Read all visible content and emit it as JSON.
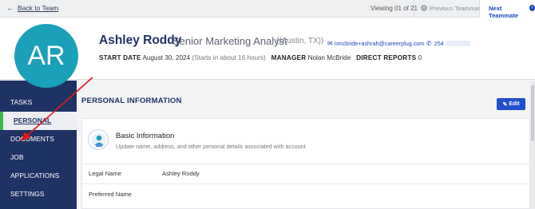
{
  "topbar": {
    "back_label": "Back to Team",
    "viewing": "Viewing 01 of 21",
    "previous_label": "Previous Teammate",
    "next_label": "Next Teammate"
  },
  "profile": {
    "initials": "AR",
    "name": "Ashley Roddy",
    "job_title": "Senior Marketing Analyst",
    "location": "((Austin, TX))",
    "email": "nmcbride+ashrah@careerplug.com",
    "phone": "254",
    "start_date_label": "START DATE",
    "start_date": "August 30, 2024",
    "start_note": "(Starts in about 16 hours)",
    "manager_label": "MANAGER",
    "manager": "Nolan McBride",
    "reports_label": "DIRECT REPORTS",
    "reports": "0"
  },
  "sidebar": {
    "items": [
      {
        "label": "TASKS"
      },
      {
        "label": "PERSONAL"
      },
      {
        "label": "DOCUMENTS"
      },
      {
        "label": "JOB"
      },
      {
        "label": "APPLICATIONS"
      },
      {
        "label": "SETTINGS"
      }
    ],
    "active": "PERSONAL"
  },
  "main": {
    "section_title": "PERSONAL INFORMATION",
    "edit_label": "Edit",
    "card": {
      "title": "Basic Information",
      "subtitle": "Update name, address, and other personal details associated with account",
      "fields": [
        {
          "label": "Legal Name",
          "value": "Ashley Roddy"
        },
        {
          "label": "Preferred Name",
          "value": ""
        }
      ]
    }
  },
  "colors": {
    "navy": "#1f3264",
    "accent_blue": "#1f4fcf",
    "avatar": "#1aa0b8",
    "active_marker": "#3cb84a",
    "annotation_arrow": "#e0191e"
  }
}
